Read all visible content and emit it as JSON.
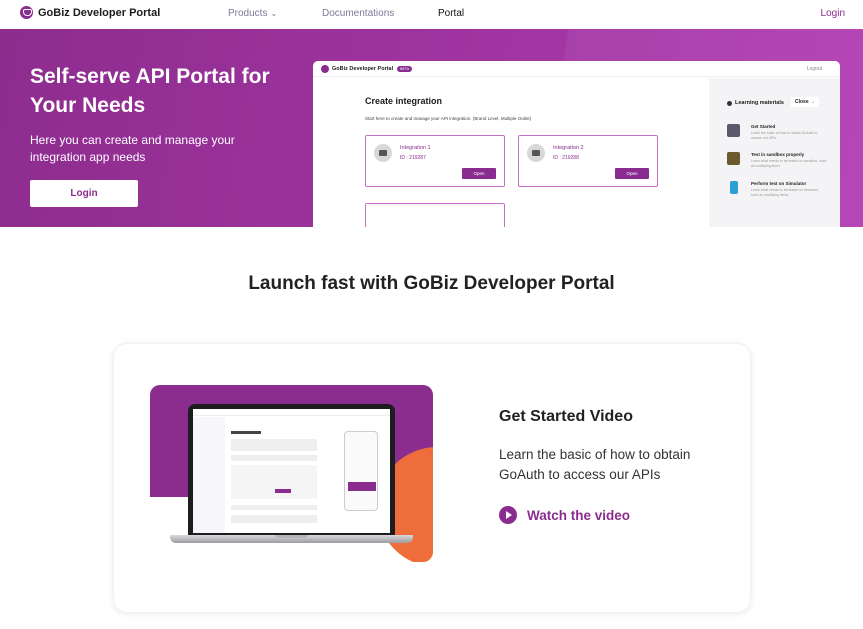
{
  "nav": {
    "brand": "GoBiz Developer Portal",
    "products": "Products",
    "documentations": "Documentations",
    "portal": "Portal",
    "login": "Login"
  },
  "hero": {
    "title": "Self-serve API Portal for Your Needs",
    "subtitle": "Here you can create and manage your integration app needs",
    "login_button": "Login"
  },
  "preview": {
    "brand": "GoBiz Developer Portal",
    "badge": "BETA",
    "logout": "Logout",
    "title": "Create integration",
    "subtitle": "Start here to create and manage your API integration. (Brand Level, Multiple Outlet)",
    "integrations": [
      {
        "name": "Integration 1",
        "id": "ID : 219287",
        "open": "Open"
      },
      {
        "name": "Integration 2",
        "id": "ID : 219288",
        "open": "Open"
      }
    ],
    "learning": {
      "heading": "Learning materials",
      "close": "Close →",
      "items": [
        {
          "title": "Get Started",
          "desc": "Learn the basic of how to obtain GoAuth to access our APIs"
        },
        {
          "title": "Test in sandbox properly",
          "desc": "Learn what needs to be tested on sandbox, such as modifying items"
        },
        {
          "title": "Perform test on Simulator",
          "desc": "Learn what needs to be tested on simulator, such as modifying items"
        }
      ]
    }
  },
  "section": {
    "title": "Launch fast with GoBiz Developer Portal"
  },
  "feature": {
    "title": "Get Started Video",
    "description": "Learn the basic of how to obtain GoAuth to access our APIs",
    "watch_label": "Watch the video"
  },
  "colors": {
    "brand": "#8a2c8f",
    "accent_orange": "#ee6d3a"
  }
}
